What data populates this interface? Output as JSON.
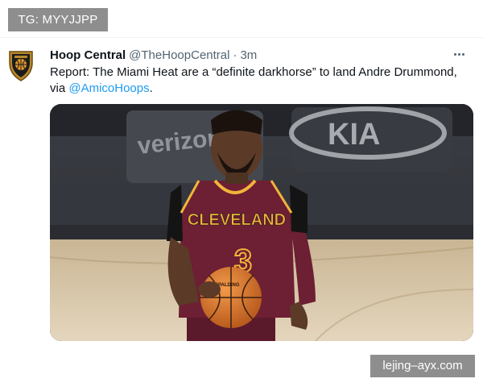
{
  "watermark_top": "TG: MYYJJPP",
  "watermark_bottom": "lejing–ayx.com",
  "tweet": {
    "author_name": "Hoop Central",
    "author_handle": "@TheHoopCentral",
    "separator": "·",
    "timestamp": "3m",
    "text_main": "Report: The Miami Heat are a “definite darkhorse” to land Andre Drummond, via ",
    "mention": "@AmicoHoops",
    "text_end": "."
  },
  "media": {
    "arena_signs": [
      "verizon",
      "KIA"
    ],
    "jersey_team": "CLEVELAND",
    "jersey_number": "3",
    "ball_brand": "SPALDING"
  },
  "colors": {
    "text": "#0f1419",
    "secondary_text": "#536471",
    "link": "#1d9bf0",
    "watermark_bg": "#8e8e8e",
    "jersey_wine": "#6d1f33",
    "jersey_gold": "#f2b43a"
  },
  "icons": {
    "avatar": "hoop-central-shield-logo",
    "more": "more-horizontal-icon"
  }
}
